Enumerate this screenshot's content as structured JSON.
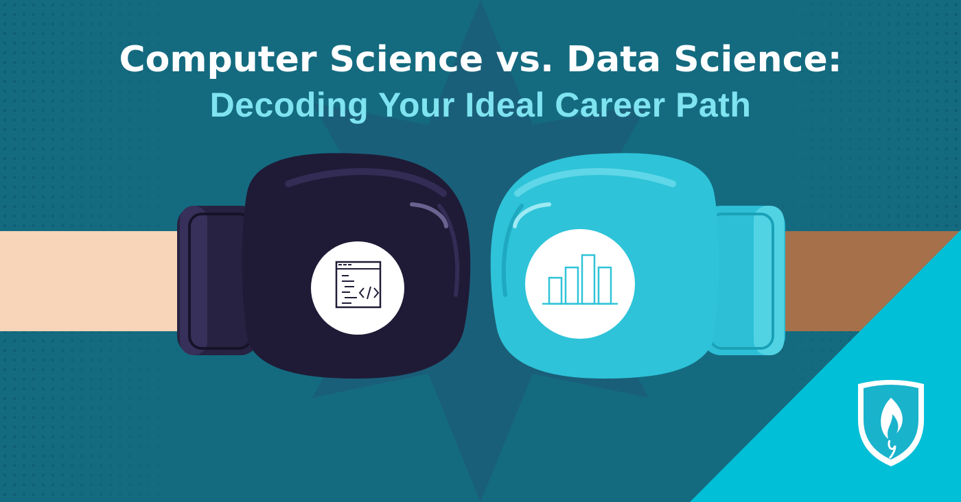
{
  "title": {
    "line1": "Computer Science vs. Data Science:",
    "line2": "Decoding Your Ideal Career Path"
  },
  "icons": {
    "left_glove": "code-window-icon",
    "right_glove": "bar-chart-icon",
    "logo": "shield-flame-logo"
  },
  "colors": {
    "background": "#146b80",
    "starburst": "#1a5f79",
    "left_arm": "#f8d4b8",
    "right_arm": "#a5704a",
    "left_glove": "#1f1b36",
    "right_glove": "#2ec3d8",
    "corner": "#00bfd6",
    "title_primary": "#ffffff",
    "title_accent": "#7fe3f0"
  }
}
